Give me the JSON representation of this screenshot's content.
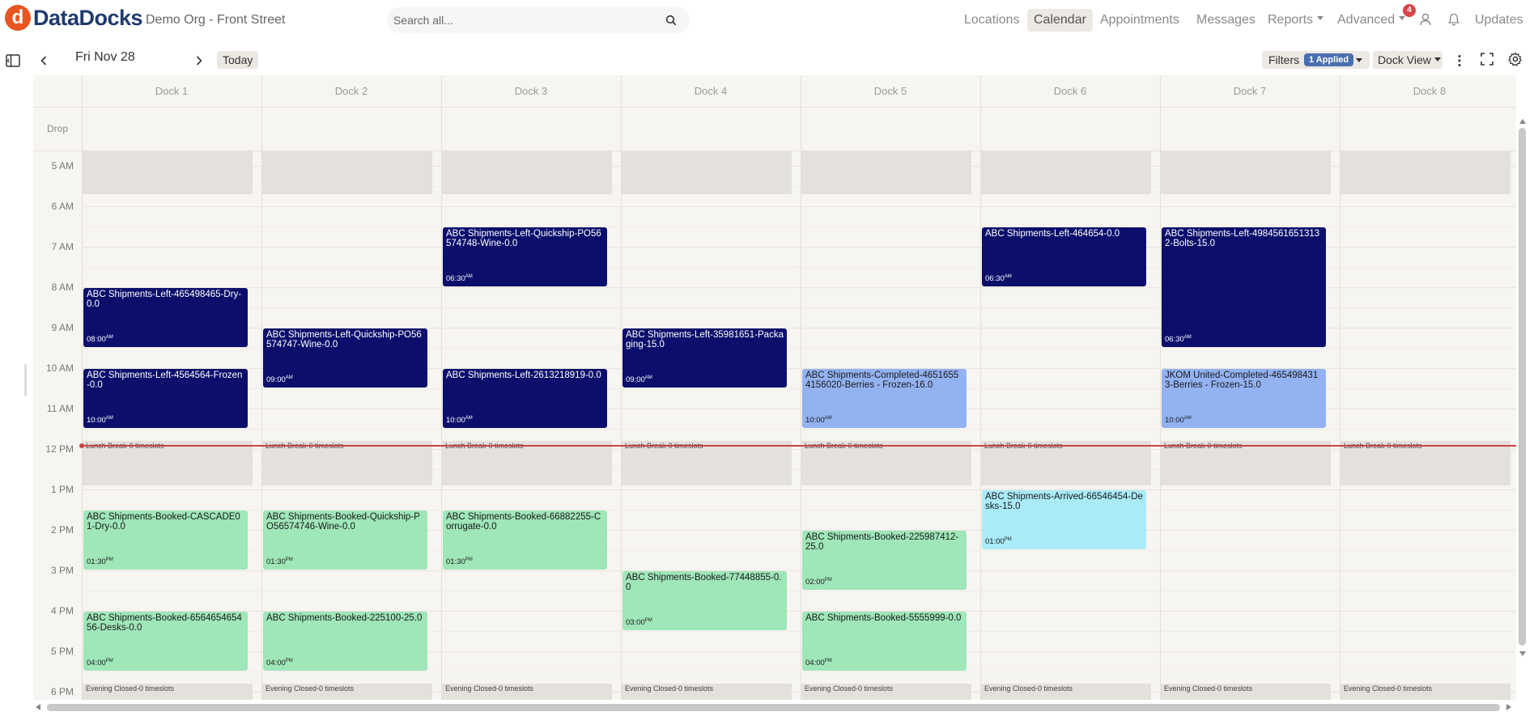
{
  "app": {
    "brand": "DataDocks",
    "org": "Demo Org - Front Street"
  },
  "search": {
    "placeholder": "Search all..."
  },
  "nav": {
    "items": [
      {
        "label": "Locations"
      },
      {
        "label": "Calendar",
        "active": true
      },
      {
        "label": "Appointments"
      },
      {
        "label": "Messages"
      },
      {
        "label": "Reports",
        "dropdown": true
      },
      {
        "label": "Advanced",
        "dropdown": true
      },
      {
        "label": "Updates"
      }
    ],
    "notification_count": "4"
  },
  "toolbar": {
    "date": "Fri Nov 28",
    "today_label": "Today",
    "filters_label": "Filters",
    "filters_applied": "1 Applied",
    "view_label": "Dock View"
  },
  "calendar": {
    "columns": [
      "Dock 1",
      "Dock 2",
      "Dock 3",
      "Dock 4",
      "Dock 5",
      "Dock 6",
      "Dock 7",
      "Dock 8"
    ],
    "drop_label": "Drop",
    "hours": [
      "5 AM",
      "6 AM",
      "7 AM",
      "8 AM",
      "9 AM",
      "10 AM",
      "11 AM",
      "12 PM",
      "1 PM",
      "2 PM",
      "3 PM",
      "4 PM",
      "5 PM",
      "6 PM"
    ],
    "lunch_label": "Lunch Break-0 timeslots",
    "evening_label": "Evening Closed-0 timeslots",
    "appointments": [
      {
        "dock": 3,
        "start": 6.5,
        "end": 8.0,
        "status": "left",
        "title": "ABC Shipments-Left-Quickship-PO56574748-Wine-0.0",
        "time": "06:30",
        "ampm": "AM"
      },
      {
        "dock": 6,
        "start": 6.5,
        "end": 8.0,
        "status": "left",
        "title": "ABC Shipments-Left-464654-0.0",
        "time": "06:30",
        "ampm": "AM"
      },
      {
        "dock": 7,
        "start": 6.5,
        "end": 9.5,
        "status": "left",
        "title": "ABC Shipments-Left-49845616513132-Bolts-15.0",
        "time": "06:30",
        "ampm": "AM"
      },
      {
        "dock": 1,
        "start": 8.0,
        "end": 9.5,
        "status": "left",
        "title": "ABC Shipments-Left-465498465-Dry-0.0",
        "time": "08:00",
        "ampm": "AM"
      },
      {
        "dock": 2,
        "start": 9.0,
        "end": 10.5,
        "status": "left",
        "title": "ABC Shipments-Left-Quickship-PO56574747-Wine-0.0",
        "time": "09:00",
        "ampm": "AM"
      },
      {
        "dock": 4,
        "start": 9.0,
        "end": 10.5,
        "status": "left",
        "title": "ABC Shipments-Left-35981651-Packaging-15.0",
        "time": "09:00",
        "ampm": "AM"
      },
      {
        "dock": 1,
        "start": 10.0,
        "end": 11.5,
        "status": "left",
        "title": "ABC Shipments-Left-4564564-Frozen-0.0",
        "time": "10:00",
        "ampm": "AM"
      },
      {
        "dock": 3,
        "start": 10.0,
        "end": 11.5,
        "status": "left",
        "title": "ABC Shipments-Left-2613218919-0.0",
        "time": "10:00",
        "ampm": "AM"
      },
      {
        "dock": 5,
        "start": 10.0,
        "end": 11.5,
        "status": "completed",
        "title": "ABC Shipments-Completed-46516554156020-Berries - Frozen-16.0",
        "time": "10:00",
        "ampm": "AM"
      },
      {
        "dock": 7,
        "start": 10.0,
        "end": 11.5,
        "status": "completed",
        "title": "JKOM United-Completed-4654984313-Berries - Frozen-15.0",
        "time": "10:00",
        "ampm": "AM"
      },
      {
        "dock": 6,
        "start": 13.0,
        "end": 14.5,
        "status": "arrived",
        "title": "ABC Shipments-Arrived-66546454-Desks-15.0",
        "time": "01:00",
        "ampm": "PM"
      },
      {
        "dock": 1,
        "start": 13.5,
        "end": 15.0,
        "status": "booked",
        "title": "ABC Shipments-Booked-CASCADE01-Dry-0.0",
        "time": "01:30",
        "ampm": "PM"
      },
      {
        "dock": 2,
        "start": 13.5,
        "end": 15.0,
        "status": "booked",
        "title": "ABC Shipments-Booked-Quickship-PO56574746-Wine-0.0",
        "time": "01:30",
        "ampm": "PM"
      },
      {
        "dock": 3,
        "start": 13.5,
        "end": 15.0,
        "status": "booked",
        "title": "ABC Shipments-Booked-66882255-Corrugate-0.0",
        "time": "01:30",
        "ampm": "PM"
      },
      {
        "dock": 5,
        "start": 14.0,
        "end": 15.5,
        "status": "booked",
        "title": "ABC Shipments-Booked-225987412-25.0",
        "time": "02:00",
        "ampm": "PM"
      },
      {
        "dock": 4,
        "start": 15.0,
        "end": 16.5,
        "status": "booked",
        "title": "ABC Shipments-Booked-77448855-0.0",
        "time": "03:00",
        "ampm": "PM"
      },
      {
        "dock": 1,
        "start": 16.0,
        "end": 17.5,
        "status": "booked",
        "title": "ABC Shipments-Booked-656465465456-Desks-0.0",
        "time": "04:00",
        "ampm": "PM"
      },
      {
        "dock": 2,
        "start": 16.0,
        "end": 17.5,
        "status": "booked",
        "title": "ABC Shipments-Booked-225100-25.0",
        "time": "04:00",
        "ampm": "PM"
      },
      {
        "dock": 5,
        "start": 16.0,
        "end": 17.5,
        "status": "booked",
        "title": "ABC Shipments-Booked-5555999-0.0",
        "time": "04:00",
        "ampm": "PM"
      }
    ]
  },
  "colors": {
    "left": "#0b0f6b",
    "completed": "#93b2f2",
    "arrived": "#a9ebf9",
    "booked": "#9fe6b8",
    "now_line": "#c94646",
    "brand": "#e8551f"
  }
}
